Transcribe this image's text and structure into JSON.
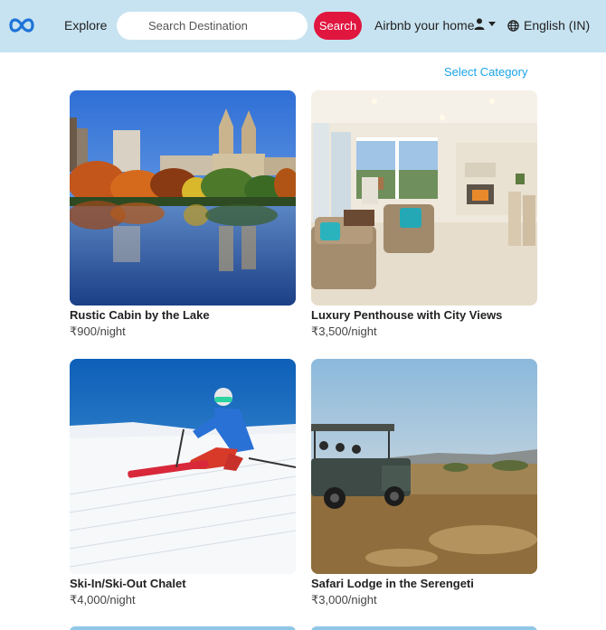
{
  "navbar": {
    "logo_icon": "infinity-logo-icon",
    "explore_label": "Explore",
    "search_placeholder": "Search Destination",
    "search_button_label": "Search",
    "host_label": "Airbnb your home",
    "user_icon": "user-icon",
    "language_icon": "globe-icon",
    "language_label": "English (IN)"
  },
  "colors": {
    "navbar_bg": "#c7e3f1",
    "search_button_bg": "#e0163f",
    "category_link": "#1aa3e8"
  },
  "select_category_label": "Select Category",
  "listings": [
    {
      "title": "Rustic Cabin by the Lake",
      "price": "₹900/night",
      "image": "lake-autumn-city-reflection"
    },
    {
      "title": "Luxury Penthouse with City Views",
      "price": "₹3,500/night",
      "image": "living-room-interior"
    },
    {
      "title": "Ski-In/Ski-Out Chalet",
      "price": "₹4,000/night",
      "image": "skier-on-slope"
    },
    {
      "title": "Safari Lodge in the Serengeti",
      "price": "₹3,000/night",
      "image": "safari-jeep-sunset"
    }
  ]
}
